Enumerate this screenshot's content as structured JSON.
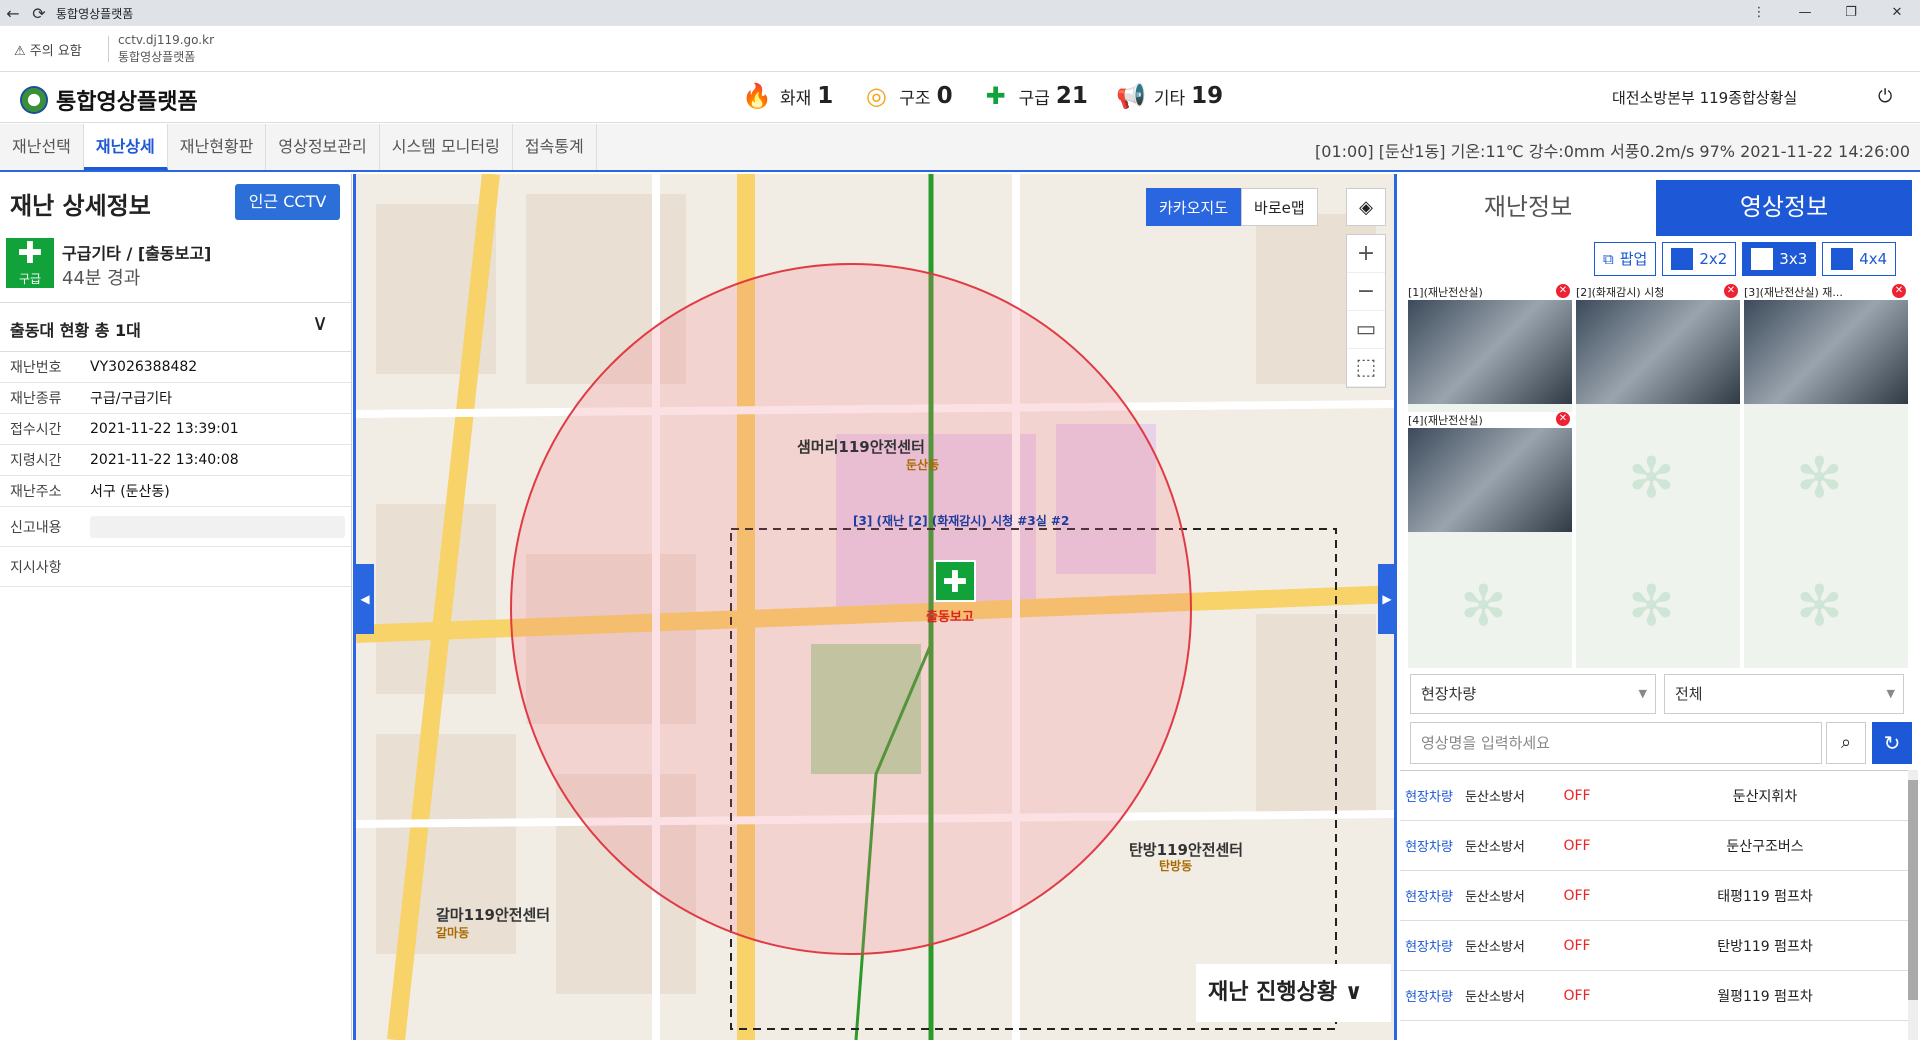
{
  "browser": {
    "title": "통합영상플랫폼",
    "warning": "주의 요함",
    "url": "cctv.dj119.go.kr",
    "page_title": "통합영상플랫폼"
  },
  "header": {
    "app_name": "통합영상플랫폼",
    "stats": [
      {
        "label": "화재",
        "count": "1",
        "icon": "fire-icon",
        "color": "#e53b24"
      },
      {
        "label": "구조",
        "count": "0",
        "icon": "lifebuoy-icon",
        "color": "#f5a418"
      },
      {
        "label": "구급",
        "count": "21",
        "icon": "medical-cross-icon",
        "color": "#11a23a"
      },
      {
        "label": "기타",
        "count": "19",
        "icon": "megaphone-icon",
        "color": "#1b6fd0"
      }
    ],
    "org": "대전소방본부 119종합상황실"
  },
  "tabs": [
    "재난선택",
    "재난상세",
    "재난현황판",
    "영상정보관리",
    "시스템 모니터링",
    "접속통계"
  ],
  "weather": "[01:00] [둔산1동]  기온:11℃  강수:0mm   서풍0.2m/s   97%  2021-11-22 14:26:00",
  "left": {
    "title": "재난 상세정보",
    "cctv_button": "인근 CCTV",
    "badge_label": "구급",
    "incident_title": "구급기타 / [출동보고]",
    "elapsed": "44분 경과",
    "unit_status": "출동대 현황 총 1대",
    "fields": [
      {
        "k": "재난번호",
        "v": "VY3026388482"
      },
      {
        "k": "재난종류",
        "v": "구급/구급기타"
      },
      {
        "k": "접수시간",
        "v": "2021-11-22 13:39:01"
      },
      {
        "k": "지령시간",
        "v": "2021-11-22 13:40:08"
      },
      {
        "k": "재난주소",
        "v": "서구 (둔산동)"
      }
    ],
    "report_label": "신고내용",
    "instruction_label": "지시사항"
  },
  "map": {
    "toggle": [
      "카카오지도",
      "바로e맵"
    ],
    "progress": "재난 진행상황",
    "center_label": "출동보고",
    "marker_text": "[3] (재난 [2] (화재감시) 시청 #3실 #2",
    "places": [
      "샘머리119안전센터",
      "둔산동",
      "탄방119안전센터",
      "탄방동",
      "갈마119안전센터",
      "갈마동"
    ]
  },
  "right": {
    "tabs": [
      "재난정보",
      "영상정보"
    ],
    "grid_buttons": [
      "팝업",
      "2x2",
      "3x3",
      "4x4"
    ],
    "tiles": [
      {
        "caption": "[1](재난전산실)"
      },
      {
        "caption": "[2](화재감시) 시청"
      },
      {
        "caption": "[3](재난전산실) 재..."
      },
      {
        "caption": "[4](재난전산실)"
      }
    ],
    "filter1": "현장차량",
    "filter2": "전체",
    "search_placeholder": "영상명을 입력하세요",
    "list": [
      {
        "type": "현장차량",
        "station": "둔산소방서",
        "status": "OFF",
        "name": "둔산지휘차"
      },
      {
        "type": "현장차량",
        "station": "둔산소방서",
        "status": "OFF",
        "name": "둔산구조버스"
      },
      {
        "type": "현장차량",
        "station": "둔산소방서",
        "status": "OFF",
        "name": "태평119 펌프차"
      },
      {
        "type": "현장차량",
        "station": "둔산소방서",
        "status": "OFF",
        "name": "탄방119 펌프차"
      },
      {
        "type": "현장차량",
        "station": "둔산소방서",
        "status": "OFF",
        "name": "월평119 펌프차"
      }
    ]
  }
}
